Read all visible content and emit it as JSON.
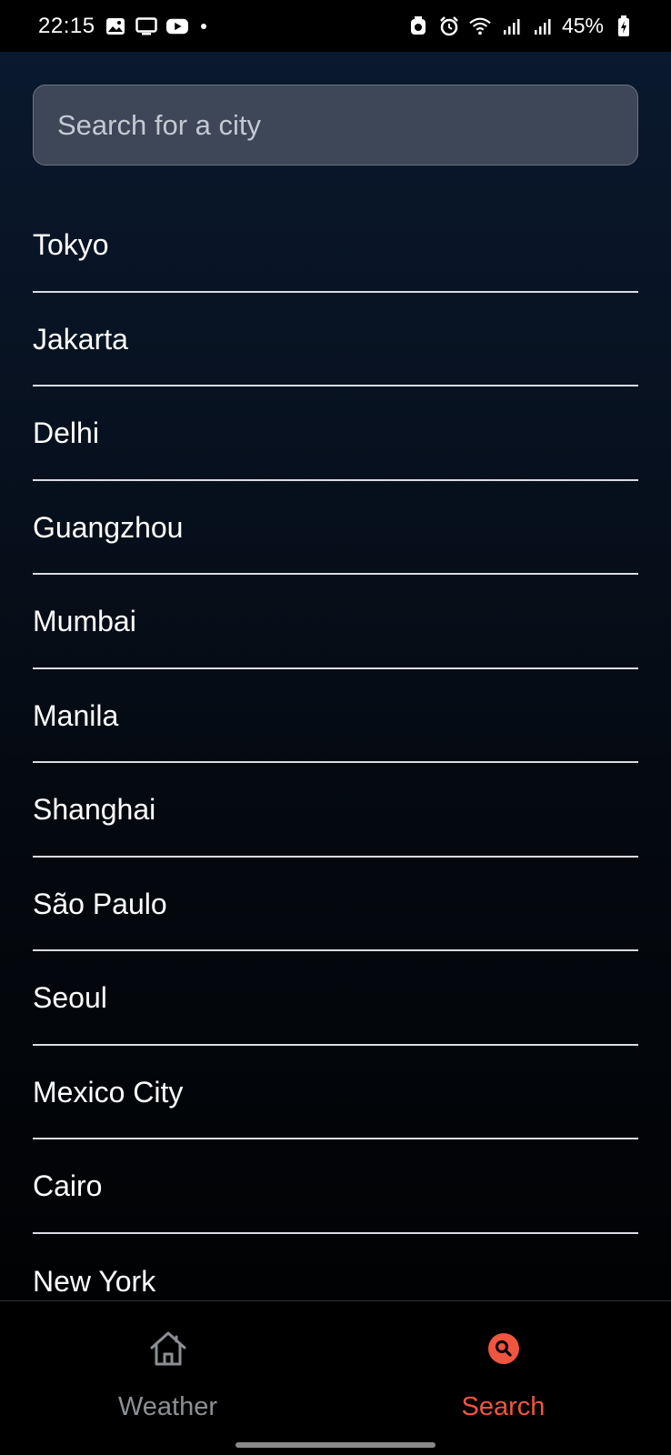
{
  "status_bar": {
    "time": "22:15",
    "battery": "45%",
    "left_icons": [
      "gallery-icon",
      "screen-cast-icon",
      "youtube-icon",
      "notification-dot"
    ],
    "right_icons": [
      "data-saver-icon",
      "alarm-icon",
      "wifi-icon",
      "signal-icon",
      "signal-icon",
      "battery-charging-icon"
    ]
  },
  "search": {
    "placeholder": "Search for a city",
    "value": ""
  },
  "cities": [
    "Tokyo",
    "Jakarta",
    "Delhi",
    "Guangzhou",
    "Mumbai",
    "Manila",
    "Shanghai",
    "São Paulo",
    "Seoul",
    "Mexico City",
    "Cairo",
    "New York"
  ],
  "bottom_nav": {
    "items": [
      {
        "label": "Weather",
        "icon": "home-icon",
        "active": false
      },
      {
        "label": "Search",
        "icon": "search-icon",
        "active": true
      }
    ]
  },
  "colors": {
    "accent": "#f0553f",
    "inactive": "#8c8f94",
    "search_bg": "#3d4757"
  }
}
